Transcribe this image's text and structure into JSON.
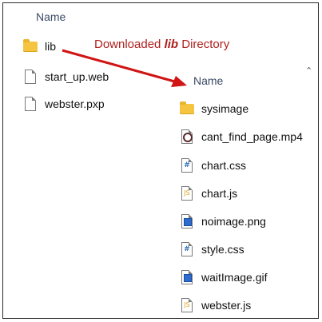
{
  "left_pane": {
    "header": "Name",
    "items": [
      {
        "name": "lib",
        "type": "folder"
      },
      {
        "name": "start_up.web",
        "type": "file"
      },
      {
        "name": "webster.pxp",
        "type": "file"
      }
    ]
  },
  "annotation": {
    "prefix": "Downloaded ",
    "emphasis": "lib",
    "suffix": " Directory",
    "color": "#b01e1e"
  },
  "right_pane": {
    "header": "Name",
    "items": [
      {
        "name": "sysimage",
        "type": "folder"
      },
      {
        "name": "cant_find_page.mp4",
        "type": "video"
      },
      {
        "name": "chart.css",
        "type": "css"
      },
      {
        "name": "chart.js",
        "type": "js"
      },
      {
        "name": "noimage.png",
        "type": "image"
      },
      {
        "name": "style.css",
        "type": "css"
      },
      {
        "name": "waitImage.gif",
        "type": "image"
      },
      {
        "name": "webster.js",
        "type": "js"
      }
    ]
  },
  "icons": {
    "folder": "folder-icon",
    "file": "file-icon",
    "sort": "chevron-up-icon"
  }
}
